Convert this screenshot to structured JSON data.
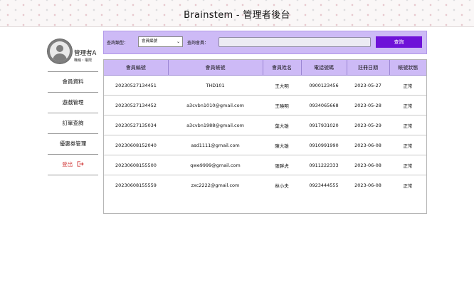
{
  "header": {
    "title": "Brainstem - 管理者後台"
  },
  "profile": {
    "name": "管理者A",
    "role": "職稱・權限"
  },
  "sidebar": {
    "items": [
      {
        "label": "會員資料"
      },
      {
        "label": "遊戲管理"
      },
      {
        "label": "訂單查詢"
      },
      {
        "label": "優惠券管理"
      },
      {
        "label": "登出"
      }
    ]
  },
  "search": {
    "type_label": "查詢類型：",
    "type_value": "會員編號",
    "member_label": "查詢會員：",
    "input_value": "",
    "button_label": "查詢"
  },
  "table": {
    "columns": [
      "會員編號",
      "會員帳號",
      "會員姓名",
      "電話號碼",
      "註冊日期",
      "帳號狀態"
    ],
    "rows": [
      [
        "20230527134451",
        "THD101",
        "王大明",
        "0900123456",
        "2023-05-27",
        "正常"
      ],
      [
        "20230527134452",
        "a3cvbn1010@gmail.com",
        "王曉明",
        "0934065668",
        "2023-05-28",
        "正常"
      ],
      [
        "20230527135034",
        "a3cvbn1988@gmail.com",
        "葉大雄",
        "0917931020",
        "2023-05-29",
        "正常"
      ],
      [
        "20230608152040",
        "asd1111@gmail.com",
        "陳大雄",
        "0910991990",
        "2023-06-08",
        "正常"
      ],
      [
        "20230608155500",
        "qwe9999@gmail.com",
        "張胖虎",
        "0911222333",
        "2023-06-08",
        "正常"
      ],
      [
        "20230608155559",
        "zxc2222@gmail.com",
        "林小夫",
        "0923444555",
        "2023-06-08",
        "正常"
      ]
    ]
  },
  "colors": {
    "accent": "#6e12d8",
    "panel": "#cdbaf6",
    "logout": "#d23c3c"
  }
}
